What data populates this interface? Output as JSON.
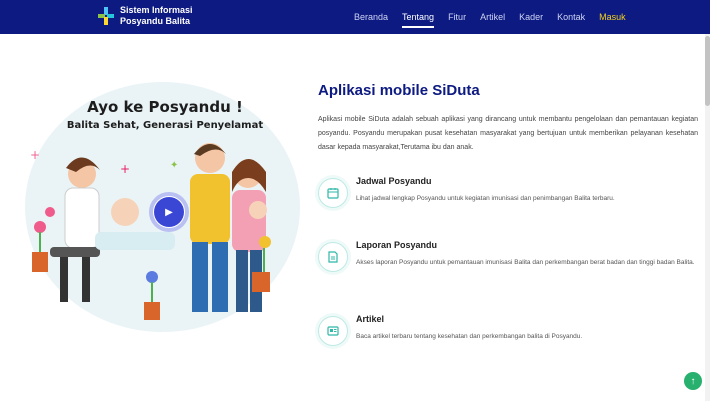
{
  "nav": {
    "brand_line1": "Sistem Informasi",
    "brand_line2": "Posyandu Balita",
    "items": [
      {
        "label": "Beranda"
      },
      {
        "label": "Tentang"
      },
      {
        "label": "Fitur"
      },
      {
        "label": "Artikel"
      },
      {
        "label": "Kader"
      },
      {
        "label": "Kontak"
      },
      {
        "label": "Masuk"
      }
    ]
  },
  "hero": {
    "title": "Ayo ke Posyandu !",
    "subtitle": "Balita Sehat, Generasi Penyelamat"
  },
  "about": {
    "title": "Aplikasi mobile SiDuta",
    "description": "Aplikasi mobile SiDuta adalah sebuah aplikasi yang dirancang untuk membantu pengelolaan dan pemantauan kegiatan posyandu. Posyandu merupakan pusat kesehatan masyarakat yang bertujuan untuk memberikan pelayanan kesehatan dasar kepada masyarakat,Terutama ibu dan anak."
  },
  "features": [
    {
      "title": "Jadwal Posyandu",
      "desc": "Lihat jadwal lengkap Posyandu untuk kegiatan imunisasi dan penimbangan Balita terbaru.",
      "icon": "calendar-icon"
    },
    {
      "title": "Laporan Posyandu",
      "desc": "Akses laporan Posyandu untuk pemantauan imunisasi Balita dan perkembangan berat badan dan tinggi badan Balita.",
      "icon": "document-icon"
    },
    {
      "title": "Artikel",
      "desc": "Baca artikel terbaru tentang kesehatan dan perkembangan balita di Posyandu.",
      "icon": "newspaper-icon"
    }
  ],
  "colors": {
    "navbar": "#0c1a82",
    "accent": "#2fb8a8",
    "login": "#f5d21a",
    "fab": "#27b06e"
  }
}
